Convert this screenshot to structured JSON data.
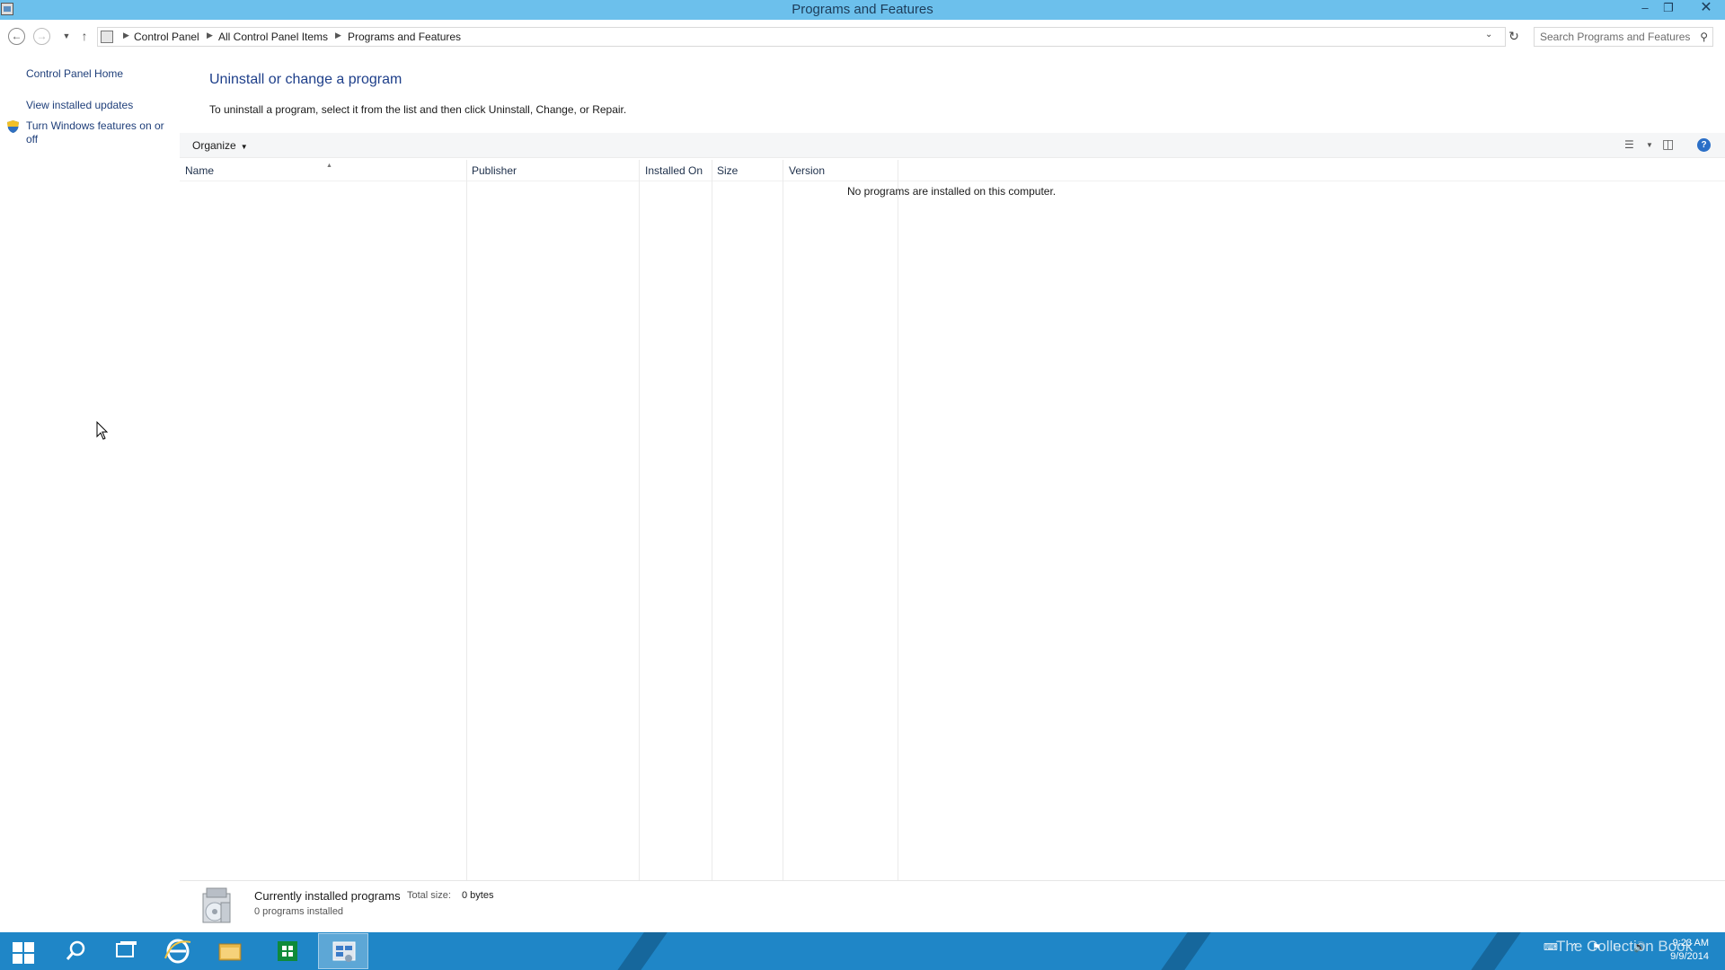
{
  "window": {
    "title": "Programs and Features"
  },
  "address": {
    "crumbs": [
      "Control Panel",
      "All Control Panel Items",
      "Programs and Features"
    ],
    "search_placeholder": "Search Programs and Features"
  },
  "leftnav": {
    "home": "Control Panel Home",
    "updates": "View installed updates",
    "features": "Turn Windows features on or off"
  },
  "main": {
    "heading": "Uninstall or change a program",
    "instructions": "To uninstall a program, select it from the list and then click Uninstall, Change, or Repair.",
    "organize_label": "Organize",
    "columns": [
      "Name",
      "Publisher",
      "Installed On",
      "Size",
      "Version"
    ],
    "empty_message": "No programs are installed on this computer."
  },
  "details": {
    "title": "Currently installed programs",
    "total_size_label": "Total size:",
    "total_size_value": "0 bytes",
    "count": "0 programs installed"
  },
  "taskbar": {
    "watermark": "The Collection Book",
    "time": "9:23 AM",
    "date": "9/9/2014",
    "accent_color": "#1f86c7"
  },
  "colors": {
    "titlebar": "#6cc0ec",
    "link": "#1f3f7a",
    "heading": "#1e3f8a"
  }
}
